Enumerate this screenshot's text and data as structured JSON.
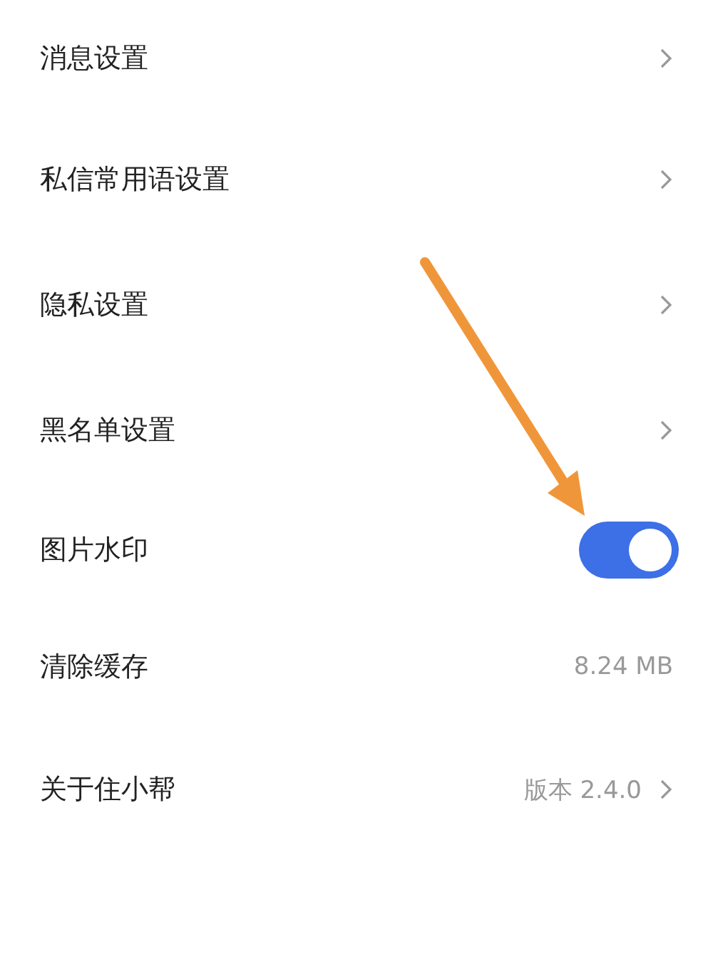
{
  "settings": [
    {
      "label": "消息设置",
      "kind": "link"
    },
    {
      "label": "私信常用语设置",
      "kind": "link"
    },
    {
      "label": "隐私设置",
      "kind": "link"
    },
    {
      "label": "黑名单设置",
      "kind": "link"
    },
    {
      "label": "图片水印",
      "kind": "toggle",
      "on": true
    },
    {
      "label": "清除缓存",
      "kind": "value",
      "value": "8.24 MB"
    },
    {
      "label": "关于住小帮",
      "kind": "value_link",
      "value": "版本 2.4.0"
    }
  ]
}
